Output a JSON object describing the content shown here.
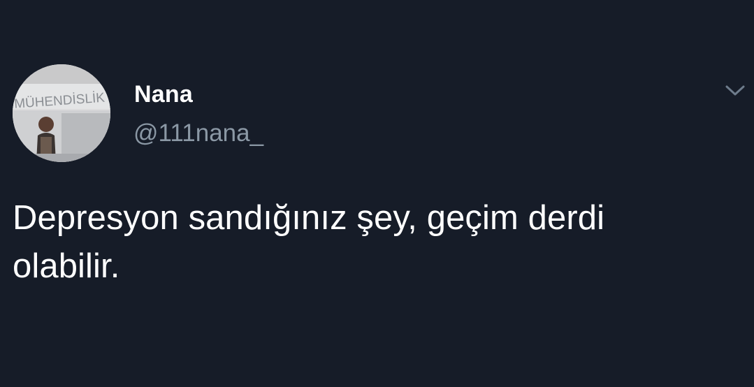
{
  "tweet": {
    "author": {
      "name": "Nana",
      "handle": "@111nana_"
    },
    "text_line1": "Depresyon sandığınız şey, geçim derdi",
    "text_line2": "olabilir.",
    "menu_icon": "chevron-down-icon",
    "avatar_wall_text": "MÜHENDİSLİK"
  },
  "colors": {
    "background": "#161c28",
    "name": "#ffffff",
    "handle": "#8b98a5",
    "text": "#ffffff",
    "chevron": "#6e7c8c"
  }
}
